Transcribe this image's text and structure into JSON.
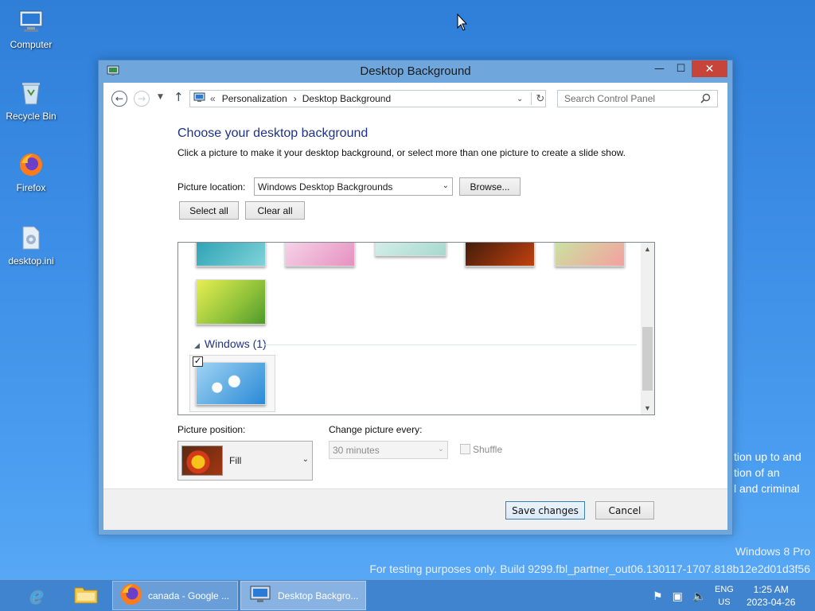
{
  "desktop": {
    "icons": [
      {
        "label": "Computer"
      },
      {
        "label": "Recycle Bin"
      },
      {
        "label": "Firefox"
      },
      {
        "label": "desktop.ini"
      }
    ],
    "background_text": [
      "tion up to and",
      "tion of an",
      "l and criminal"
    ],
    "watermark": {
      "line1": "Windows 8 Pro",
      "line2": "For testing purposes only. Build 9299.fbl_partner_out06.130117-1707.818b12e2d01d3f56"
    }
  },
  "window": {
    "title": "Desktop Background",
    "buttons": {
      "minimize": "—",
      "maximize": "☐",
      "close": "✕"
    },
    "address": {
      "prefix": "«",
      "crumbs": [
        "Personalization",
        "Desktop Background"
      ],
      "separator": "›"
    },
    "search": {
      "placeholder": "Search Control Panel"
    },
    "heading": "Choose your desktop background",
    "description": "Click a picture to make it your desktop background, or select more than one picture to create a slide show.",
    "picture_location": {
      "label": "Picture location:",
      "value": "Windows Desktop Backgrounds",
      "browse": "Browse..."
    },
    "select_all": "Select all",
    "clear_all": "Clear all",
    "gallery": {
      "group_label": "Windows (1)",
      "selected_checked": "✓"
    },
    "picture_position": {
      "label": "Picture position:",
      "value": "Fill"
    },
    "change_every": {
      "label": "Change picture every:",
      "value": "30 minutes"
    },
    "shuffle": {
      "label": "Shuffle",
      "checked": false
    },
    "save_changes": "Save changes",
    "cancel": "Cancel"
  },
  "taskbar": {
    "items": [
      {
        "label": "canada - Google ..."
      },
      {
        "label": "Desktop Backgro..."
      }
    ],
    "lang": {
      "line1": "ENG",
      "line2": "US"
    },
    "clock": {
      "time": "1:25 AM",
      "date": "2023-04-26"
    }
  },
  "colors": {
    "accent": "#1e3287",
    "close": "#c7443b",
    "desktop": "#3d8ee6"
  }
}
